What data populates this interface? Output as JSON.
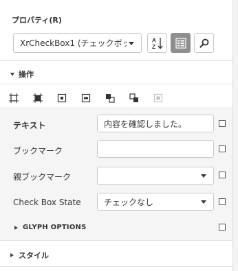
{
  "panel": {
    "title": "プロパティ(R)"
  },
  "selector": {
    "value": "XrCheckBox1 (チェックボッ..."
  },
  "toolbar": {
    "sort_icon": "sort-alphabetical-icon",
    "categorized_icon": "categorized-view-icon",
    "search_icon": "search-icon"
  },
  "sections": {
    "actions": "操作",
    "style": "スタイル"
  },
  "alignment_icons": [
    "align-left-icon",
    "align-top-icon",
    "center-horizontal-icon",
    "center-vertical-icon",
    "bring-to-front-icon",
    "send-to-back-icon",
    "fit-bounds-icon"
  ],
  "properties": [
    {
      "label": "テキスト",
      "value": "内容を確認しました。",
      "type": "text"
    },
    {
      "label": "ブックマーク",
      "value": "",
      "type": "text"
    },
    {
      "label": "親ブックマーク",
      "value": "",
      "type": "dropdown"
    },
    {
      "label": "Check Box State",
      "value": "チェックなし",
      "type": "dropdown"
    }
  ],
  "glyph_options": {
    "label": "GLYPH OPTIONS"
  },
  "colors": {
    "active_button": "#8e8e8e",
    "property_background": "#f5f5f5"
  }
}
